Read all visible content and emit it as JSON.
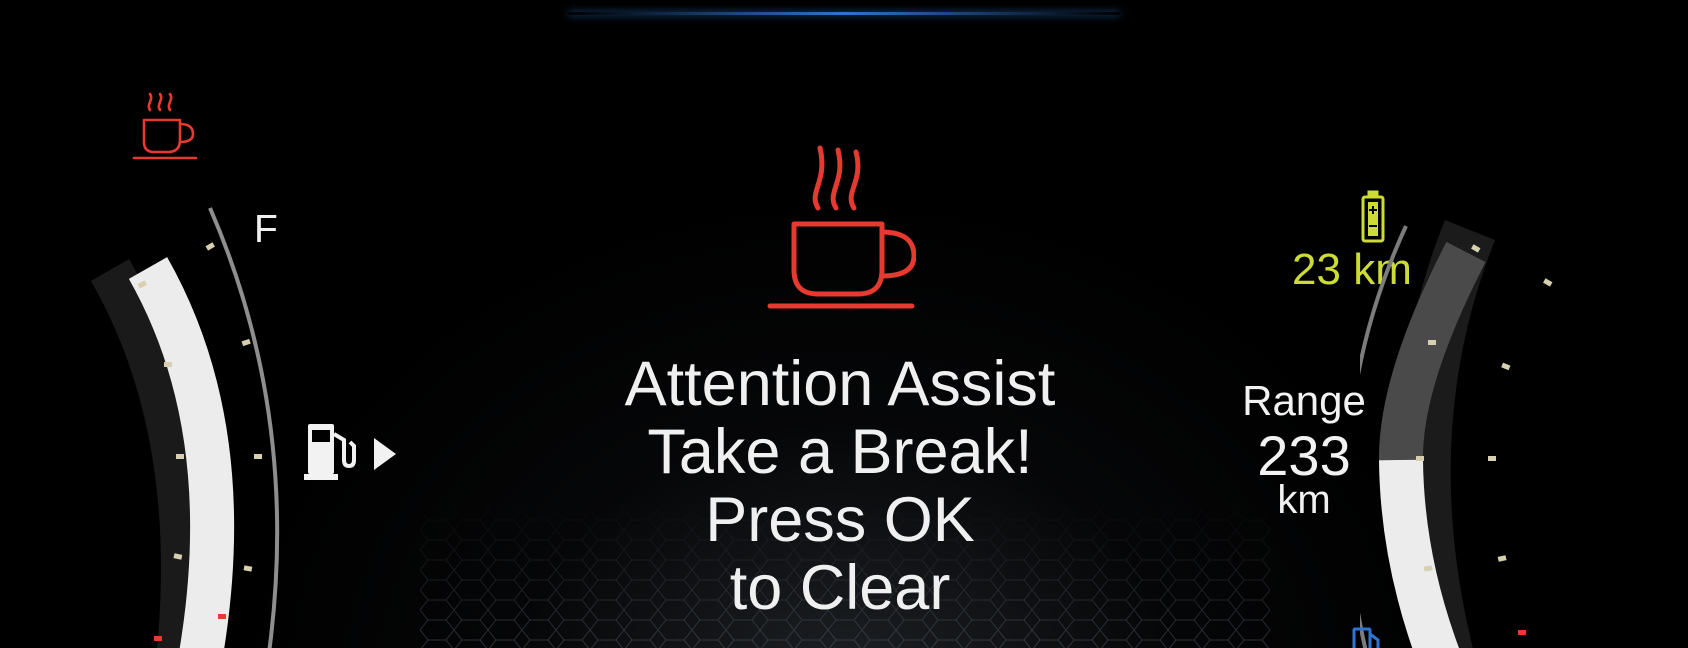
{
  "warning": {
    "icon": "coffee-cup-icon",
    "lines": [
      "Attention Assist",
      "Take a Break!",
      "Press OK",
      "to Clear"
    ]
  },
  "fuel_gauge": {
    "full_label": "F",
    "pump_icon": "fuel-pump-icon",
    "level_fraction": 0.88
  },
  "ev": {
    "battery_icon": "battery-icon",
    "range_value": "23",
    "range_unit": "km"
  },
  "range": {
    "label": "Range",
    "value": "233",
    "unit": "km"
  },
  "colors": {
    "warning_red": "#e6392f",
    "ev_green": "#cddc35",
    "accent_blue": "#2f74d0",
    "text_white": "#f0f0f0"
  }
}
